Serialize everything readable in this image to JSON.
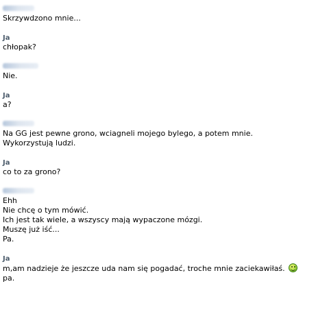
{
  "conversation": {
    "self_name": "Ja",
    "messages": [
      {
        "sender": "other",
        "lines": [
          "Skrzywdzono mnie..."
        ]
      },
      {
        "sender": "self",
        "lines": [
          "chłopak?"
        ]
      },
      {
        "sender": "other",
        "lines": [
          "Nie."
        ]
      },
      {
        "sender": "self",
        "lines": [
          "a?"
        ]
      },
      {
        "sender": "other",
        "lines": [
          "Na GG jest pewne grono, wciagneli mojego bylego, a potem mnie.",
          "Wykorzystują ludzi."
        ]
      },
      {
        "sender": "self",
        "lines": [
          "co to za grono?"
        ]
      },
      {
        "sender": "other",
        "lines": [
          "Ehh",
          "Nie chcę o tym mówić.",
          "Ich jest tak wiele, a wszyscy mają wypaczone mózgi.",
          "Muszę już iść...",
          "Pa."
        ]
      },
      {
        "sender": "self",
        "lines": [
          "m,am nadzieje że jeszcze uda nam się pogadać, troche mnie zaciekawiłaś.",
          "pa."
        ]
      }
    ],
    "emoticon": "laughing-smiley-icon"
  }
}
